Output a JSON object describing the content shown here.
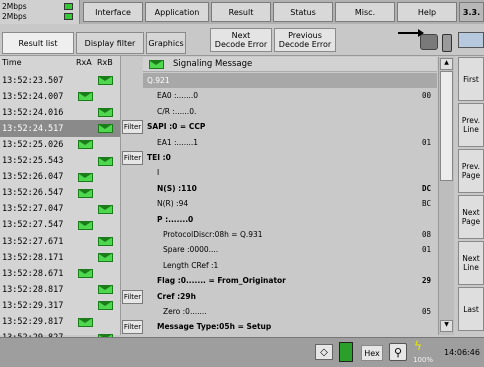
{
  "top": {
    "rate1": "2Mbps",
    "rate2": "2Mbps",
    "tabs": [
      "Interface",
      "Application",
      "Result",
      "Status",
      "Misc.",
      "Help",
      "3.3."
    ]
  },
  "toolbar": {
    "result_list": "Result list",
    "display_filter": "Display filter",
    "graphics": "Graphics",
    "next_decode_error": "Next\nDecode Error",
    "previous_decode_error": "Previous\nDecode Error"
  },
  "list_header": {
    "time": "Time",
    "rxa": "RxA",
    "rxb": "RxB"
  },
  "rows": [
    {
      "time": "13:52:23.507",
      "col": "b",
      "selected": false
    },
    {
      "time": "13:52:24.007",
      "col": "a",
      "selected": false
    },
    {
      "time": "13:52:24.016",
      "col": "b",
      "selected": false
    },
    {
      "time": "13:52:24.517",
      "col": "b",
      "selected": true
    },
    {
      "time": "13:52:25.026",
      "col": "a",
      "selected": false
    },
    {
      "time": "13:52:25.543",
      "col": "b",
      "selected": false
    },
    {
      "time": "13:52:26.047",
      "col": "a",
      "selected": false
    },
    {
      "time": "13:52:26.547",
      "col": "a",
      "selected": false
    },
    {
      "time": "13:52:27.047",
      "col": "b",
      "selected": false
    },
    {
      "time": "13:52:27.547",
      "col": "a",
      "selected": false
    },
    {
      "time": "13:52:27.671",
      "col": "b",
      "selected": false
    },
    {
      "time": "13:52:28.171",
      "col": "b",
      "selected": false
    },
    {
      "time": "13:52:28.671",
      "col": "a",
      "selected": false
    },
    {
      "time": "13:52:28.817",
      "col": "b",
      "selected": false
    },
    {
      "time": "13:52:29.317",
      "col": "b",
      "selected": false
    },
    {
      "time": "13:52:29.817",
      "col": "a",
      "selected": false
    },
    {
      "time": "13:52:29.827",
      "col": "b",
      "selected": false
    }
  ],
  "decode": {
    "title": "Signaling Message",
    "lines": [
      {
        "label": "Q.921",
        "value": "",
        "bold": false,
        "filter": false,
        "style": "group"
      },
      {
        "label": "EA0 :.......0",
        "value": "00",
        "bold": false,
        "filter": false,
        "style": "indent"
      },
      {
        "label": "C/R :......0.",
        "value": "",
        "bold": false,
        "filter": false,
        "style": "indent"
      },
      {
        "label": "SAPI :0 = CCP",
        "value": "",
        "bold": true,
        "filter": true,
        "style": "plain"
      },
      {
        "label": "EA1 :.......1",
        "value": "01",
        "bold": false,
        "filter": false,
        "style": "indent"
      },
      {
        "label": "TEI :0",
        "value": "",
        "bold": true,
        "filter": true,
        "style": "plain"
      },
      {
        "label": "I",
        "value": "",
        "bold": false,
        "filter": false,
        "style": "indent"
      },
      {
        "label": "N(S) :110",
        "value": "DC",
        "bold": true,
        "filter": false,
        "style": "indent"
      },
      {
        "label": "N(R) :94",
        "value": "BC",
        "bold": false,
        "filter": false,
        "style": "indent"
      },
      {
        "label": "P :.......0",
        "value": "",
        "bold": true,
        "filter": false,
        "style": "indent"
      },
      {
        "label": "ProtocolDiscr:08h = Q.931",
        "value": "08",
        "bold": false,
        "filter": false,
        "style": "indent2"
      },
      {
        "label": "Spare :0000....",
        "value": "01",
        "bold": false,
        "filter": false,
        "style": "indent2"
      },
      {
        "label": "Length CRef :1",
        "value": "",
        "bold": false,
        "filter": false,
        "style": "indent2"
      },
      {
        "label": "Flag :0....... = From_Originator",
        "value": "29",
        "bold": true,
        "filter": false,
        "style": "indent"
      },
      {
        "label": "Cref :29h",
        "value": "",
        "bold": true,
        "filter": true,
        "style": "indent"
      },
      {
        "label": "Zero :0.......",
        "value": "05",
        "bold": false,
        "filter": false,
        "style": "indent2"
      },
      {
        "label": "Message Type:05h = Setup",
        "value": "",
        "bold": true,
        "filter": true,
        "style": "indent"
      }
    ],
    "filter_label": "Filter"
  },
  "side_buttons": [
    "First",
    "Prev.\nLine",
    "Prev.\nPage",
    "Next\nPage",
    "Next\nLine",
    "Last"
  ],
  "status": {
    "hex": "Hex",
    "zoom": "100%",
    "clock": "14:06:46"
  },
  "colors": {
    "selected_row": "#8a8a8a",
    "group_row": "#a8a8a8",
    "envelope": "#4fd84f"
  }
}
